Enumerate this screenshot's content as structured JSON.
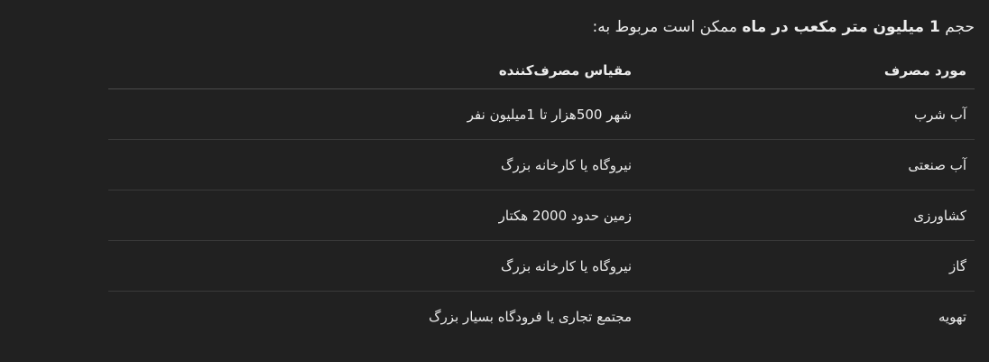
{
  "intro": {
    "prefix": "حجم ",
    "bold": "1 میلیون متر مکعب در ماه",
    "suffix": " ممکن است مربوط به:"
  },
  "table": {
    "headers": [
      "مورد مصرف",
      "مقیاس مصرف‌کننده"
    ],
    "rows": [
      [
        "آب شرب",
        "شهر 500هزار تا 1میلیون نفر"
      ],
      [
        "آب صنعتی",
        "نیروگاه یا کارخانه بزرگ"
      ],
      [
        "کشاورزی",
        "زمین حدود 2000 هکتار"
      ],
      [
        "گاز",
        "نیروگاه یا کارخانه بزرگ"
      ],
      [
        "تهویه",
        "مجتمع تجاری یا فرودگاه بسیار بزرگ"
      ]
    ]
  }
}
